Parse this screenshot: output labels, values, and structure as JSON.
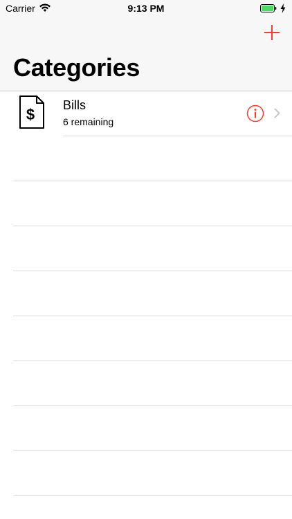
{
  "status_bar": {
    "carrier": "Carrier",
    "time": "9:13 PM",
    "battery_color": "#4cd964"
  },
  "nav": {
    "title": "Categories",
    "add_icon": "plus-icon",
    "accent_color": "#ff3b30"
  },
  "categories": [
    {
      "icon": "dollar-document-icon",
      "title": "Bills",
      "subtitle": "6 remaining"
    }
  ],
  "empty_row_count": 8
}
